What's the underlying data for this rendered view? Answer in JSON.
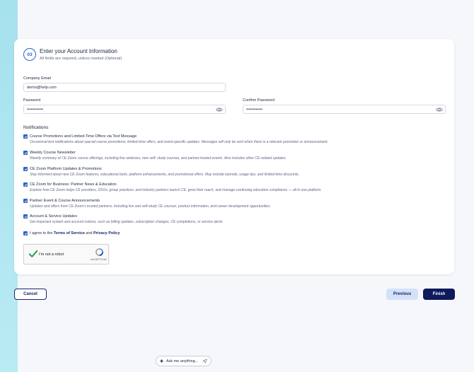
{
  "section": {
    "step_number": "03",
    "title": "Enter your Account Information",
    "subtitle": "All fields are required, unless marked (Optional)."
  },
  "form": {
    "company_email": {
      "label": "Company Email",
      "value": "demo@help.com"
    },
    "password": {
      "label": "Password",
      "value": "••••••••••••"
    },
    "confirm_password": {
      "label": "Confirm Password",
      "value": "••••••••••••"
    }
  },
  "notifications": {
    "heading": "Notifications",
    "items": [
      {
        "title": "Course Promotions and Limited-Time Offers via Text Message",
        "description": "Occasional text notifications about special course promotions, limited-time offers, and event-specific updates. Messages will only be sent when there is a relevant promotion or announcement."
      },
      {
        "title": "Weekly Course Newsletter",
        "description": "Weekly summary of CE Zoom course offerings, including live webinars, new self- study courses, and partner-hosted events. Also includes other CE-related updates."
      },
      {
        "title": "CE Zoom Platform Updates & Promotions",
        "description": "Stay informed about new CE Zoom features, educational tools, platform enhancements, and promotional offers. May include tutorials, usage tips, and limited-time discounts."
      },
      {
        "title": "CE Zoom for Business: Partner News & Education",
        "description": "Explore how CE Zoom helps CE providers, DSOs, group practices, and industry partners launch CE, grow their reach, and manage continuing education compliance — all in one platform."
      },
      {
        "title": "Partner Event & Course Announcements",
        "description": "Updates and offers from CE Zoom's trusted partners, including live and self-study CE courses, product information, and career development opportunities."
      },
      {
        "title": "Account & Service Updates",
        "description": "Get important system and account notices, such as billing updates, subscription changes, CE completions, or service alerts."
      }
    ]
  },
  "agreement": {
    "prefix": "I agree to the ",
    "terms_link": "Terms of Service",
    "and": " and ",
    "privacy_link": "Privacy Policy"
  },
  "recaptcha": {
    "label": "I'm not a robot",
    "brand": "reCAPTCHA"
  },
  "buttons": {
    "cancel": "Cancel",
    "previous": "Previous",
    "finish": "Finish"
  },
  "assistant": {
    "placeholder": "Ask me anything..."
  },
  "colors": {
    "accent": "#2d63c8",
    "primary_dark": "#0e1a5c",
    "secondary_button": "#d4e2f7"
  },
  "icons": {
    "password_toggle": "eye-icon",
    "checkbox": "check-icon",
    "assistant": "sparkle-icon",
    "send": "send-icon"
  }
}
